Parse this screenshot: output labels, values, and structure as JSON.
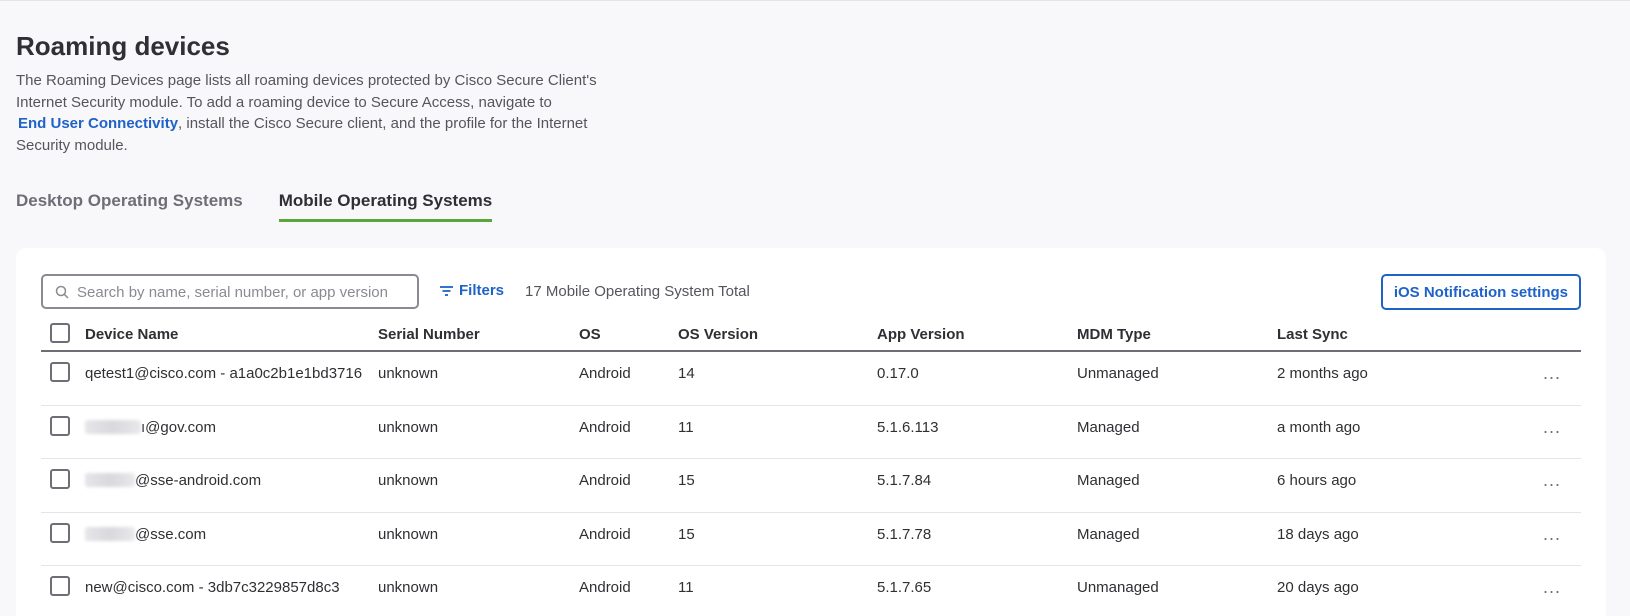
{
  "page": {
    "title": "Roaming devices",
    "description_part1": "The Roaming Devices page lists all roaming devices protected by Cisco Secure Client's Internet Security module. To add a roaming device to Secure Access, navigate to",
    "description_link": "End User Connectivity",
    "description_part2": ", install the Cisco Secure client, and the profile for the Internet Security module."
  },
  "tabs": [
    {
      "label": "Desktop Operating Systems",
      "active": false
    },
    {
      "label": "Mobile Operating Systems",
      "active": true
    }
  ],
  "toolbar": {
    "search_placeholder": "Search by name, serial number, or app version",
    "search_value": "",
    "filters_label": "Filters",
    "total_label": "17 Mobile Operating System Total",
    "ios_button_label": "iOS Notification settings"
  },
  "table": {
    "columns": [
      "Device Name",
      "Serial Number",
      "OS",
      "OS Version",
      "App Version",
      "MDM Type",
      "Last Sync"
    ],
    "rows": [
      {
        "name": "qetest1@cisco.com - a1a0c2b1e1bd3716",
        "serial": "unknown",
        "os": "Android",
        "os_version": "14",
        "app_version": "0.17.0",
        "mdm": "Unmanaged",
        "sync": "2 months ago"
      },
      {
        "name": "ı@gov.com",
        "serial": "unknown",
        "os": "Android",
        "os_version": "11",
        "app_version": "5.1.6.113",
        "mdm": "Managed",
        "sync": "a month ago"
      },
      {
        "name": "@sse-android.com",
        "serial": "unknown",
        "os": "Android",
        "os_version": "15",
        "app_version": "5.1.7.84",
        "mdm": "Managed",
        "sync": "6 hours ago"
      },
      {
        "name": "@sse.com",
        "serial": "unknown",
        "os": "Android",
        "os_version": "15",
        "app_version": "5.1.7.78",
        "mdm": "Managed",
        "sync": "18 days ago"
      },
      {
        "name": "new@cisco.com - 3db7c3229857d8c3",
        "serial": "unknown",
        "os": "Android",
        "os_version": "11",
        "app_version": "5.1.7.65",
        "mdm": "Unmanaged",
        "sync": "20 days ago"
      }
    ],
    "row_menu_glyph": "..."
  },
  "colors": {
    "accent": "#1f62c8",
    "active_tab_underline": "#5ba63b",
    "background": "#f8f8fa"
  },
  "icons": {
    "search": "search-icon",
    "filters": "filter-icon",
    "row_menu": "more-options-icon"
  }
}
